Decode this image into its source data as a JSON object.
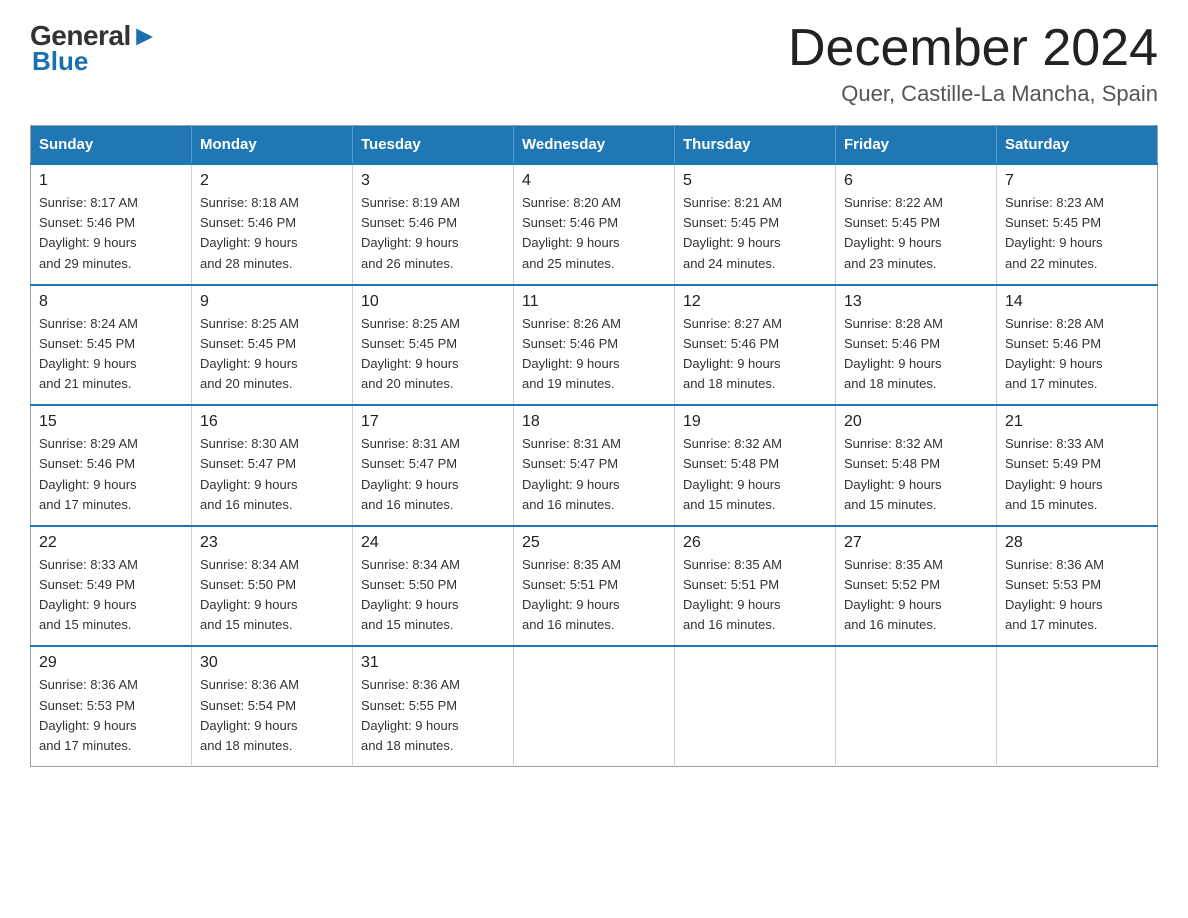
{
  "header": {
    "logo_general": "General",
    "logo_blue": "Blue",
    "main_title": "December 2024",
    "subtitle": "Quer, Castille-La Mancha, Spain"
  },
  "calendar": {
    "headers": [
      "Sunday",
      "Monday",
      "Tuesday",
      "Wednesday",
      "Thursday",
      "Friday",
      "Saturday"
    ],
    "weeks": [
      [
        {
          "day": "1",
          "sunrise": "8:17 AM",
          "sunset": "5:46 PM",
          "daylight": "9 hours and 29 minutes."
        },
        {
          "day": "2",
          "sunrise": "8:18 AM",
          "sunset": "5:46 PM",
          "daylight": "9 hours and 28 minutes."
        },
        {
          "day": "3",
          "sunrise": "8:19 AM",
          "sunset": "5:46 PM",
          "daylight": "9 hours and 26 minutes."
        },
        {
          "day": "4",
          "sunrise": "8:20 AM",
          "sunset": "5:46 PM",
          "daylight": "9 hours and 25 minutes."
        },
        {
          "day": "5",
          "sunrise": "8:21 AM",
          "sunset": "5:45 PM",
          "daylight": "9 hours and 24 minutes."
        },
        {
          "day": "6",
          "sunrise": "8:22 AM",
          "sunset": "5:45 PM",
          "daylight": "9 hours and 23 minutes."
        },
        {
          "day": "7",
          "sunrise": "8:23 AM",
          "sunset": "5:45 PM",
          "daylight": "9 hours and 22 minutes."
        }
      ],
      [
        {
          "day": "8",
          "sunrise": "8:24 AM",
          "sunset": "5:45 PM",
          "daylight": "9 hours and 21 minutes."
        },
        {
          "day": "9",
          "sunrise": "8:25 AM",
          "sunset": "5:45 PM",
          "daylight": "9 hours and 20 minutes."
        },
        {
          "day": "10",
          "sunrise": "8:25 AM",
          "sunset": "5:45 PM",
          "daylight": "9 hours and 20 minutes."
        },
        {
          "day": "11",
          "sunrise": "8:26 AM",
          "sunset": "5:46 PM",
          "daylight": "9 hours and 19 minutes."
        },
        {
          "day": "12",
          "sunrise": "8:27 AM",
          "sunset": "5:46 PM",
          "daylight": "9 hours and 18 minutes."
        },
        {
          "day": "13",
          "sunrise": "8:28 AM",
          "sunset": "5:46 PM",
          "daylight": "9 hours and 18 minutes."
        },
        {
          "day": "14",
          "sunrise": "8:28 AM",
          "sunset": "5:46 PM",
          "daylight": "9 hours and 17 minutes."
        }
      ],
      [
        {
          "day": "15",
          "sunrise": "8:29 AM",
          "sunset": "5:46 PM",
          "daylight": "9 hours and 17 minutes."
        },
        {
          "day": "16",
          "sunrise": "8:30 AM",
          "sunset": "5:47 PM",
          "daylight": "9 hours and 16 minutes."
        },
        {
          "day": "17",
          "sunrise": "8:31 AM",
          "sunset": "5:47 PM",
          "daylight": "9 hours and 16 minutes."
        },
        {
          "day": "18",
          "sunrise": "8:31 AM",
          "sunset": "5:47 PM",
          "daylight": "9 hours and 16 minutes."
        },
        {
          "day": "19",
          "sunrise": "8:32 AM",
          "sunset": "5:48 PM",
          "daylight": "9 hours and 15 minutes."
        },
        {
          "day": "20",
          "sunrise": "8:32 AM",
          "sunset": "5:48 PM",
          "daylight": "9 hours and 15 minutes."
        },
        {
          "day": "21",
          "sunrise": "8:33 AM",
          "sunset": "5:49 PM",
          "daylight": "9 hours and 15 minutes."
        }
      ],
      [
        {
          "day": "22",
          "sunrise": "8:33 AM",
          "sunset": "5:49 PM",
          "daylight": "9 hours and 15 minutes."
        },
        {
          "day": "23",
          "sunrise": "8:34 AM",
          "sunset": "5:50 PM",
          "daylight": "9 hours and 15 minutes."
        },
        {
          "day": "24",
          "sunrise": "8:34 AM",
          "sunset": "5:50 PM",
          "daylight": "9 hours and 15 minutes."
        },
        {
          "day": "25",
          "sunrise": "8:35 AM",
          "sunset": "5:51 PM",
          "daylight": "9 hours and 16 minutes."
        },
        {
          "day": "26",
          "sunrise": "8:35 AM",
          "sunset": "5:51 PM",
          "daylight": "9 hours and 16 minutes."
        },
        {
          "day": "27",
          "sunrise": "8:35 AM",
          "sunset": "5:52 PM",
          "daylight": "9 hours and 16 minutes."
        },
        {
          "day": "28",
          "sunrise": "8:36 AM",
          "sunset": "5:53 PM",
          "daylight": "9 hours and 17 minutes."
        }
      ],
      [
        {
          "day": "29",
          "sunrise": "8:36 AM",
          "sunset": "5:53 PM",
          "daylight": "9 hours and 17 minutes."
        },
        {
          "day": "30",
          "sunrise": "8:36 AM",
          "sunset": "5:54 PM",
          "daylight": "9 hours and 18 minutes."
        },
        {
          "day": "31",
          "sunrise": "8:36 AM",
          "sunset": "5:55 PM",
          "daylight": "9 hours and 18 minutes."
        },
        null,
        null,
        null,
        null
      ]
    ]
  }
}
